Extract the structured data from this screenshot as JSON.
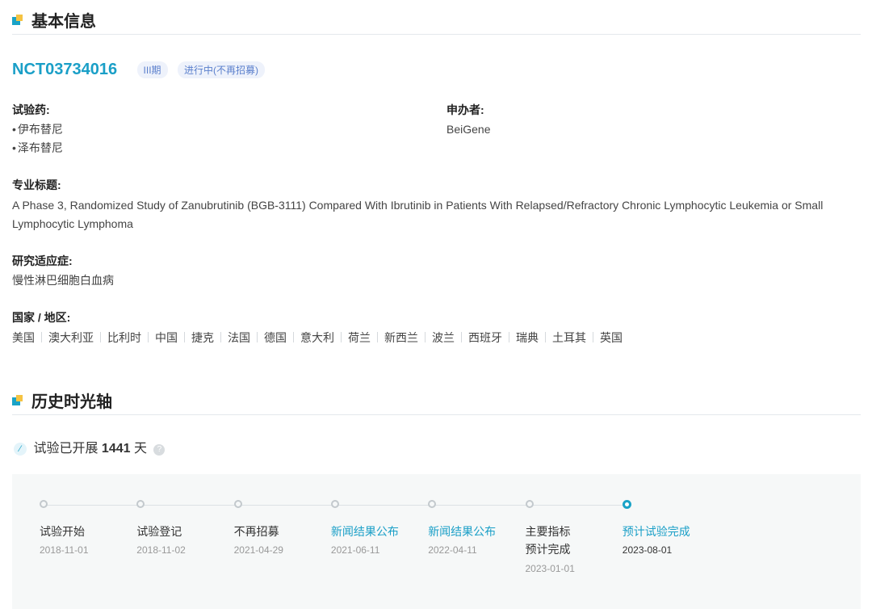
{
  "sections": {
    "basic_info": "基本信息",
    "timeline": "历史时光轴"
  },
  "trial": {
    "nct_id": "NCT03734016",
    "tags": [
      "III期",
      "进行中(不再招募)"
    ],
    "drug_label": "试验药:",
    "drugs": [
      "伊布替尼",
      "泽布替尼"
    ],
    "sponsor_label": "申办者:",
    "sponsor": "BeiGene",
    "title_label": "专业标题:",
    "title_line1": "A Phase 3, Randomized Study of Zanubrutinib (BGB-3111) Compared With Ibrutinib in Patients With Relapsed/Refractory Chronic Lymphocytic Leukemia or Small",
    "title_line2": "Lymphocytic Lymphoma",
    "indication_label": "研究适应症:",
    "indication": "慢性淋巴细胞白血病",
    "countries_label": "国家 / 地区:",
    "countries": [
      "美国",
      "澳大利亚",
      "比利时",
      "中国",
      "捷克",
      "法国",
      "德国",
      "意大利",
      "荷兰",
      "新西兰",
      "波兰",
      "西班牙",
      "瑞典",
      "土耳其",
      "英国"
    ]
  },
  "duration": {
    "prefix": "试验已开展",
    "days": "1441",
    "suffix": "天",
    "clip_icon": "paperclip-icon",
    "help_icon": "question-icon"
  },
  "timeline": [
    {
      "label": "试验开始",
      "date": "2018-11-01"
    },
    {
      "label": "试验登记",
      "date": "2018-11-02"
    },
    {
      "label": "不再招募",
      "date": "2021-04-29"
    },
    {
      "label": "新闻结果公布",
      "date": "2021-06-11"
    },
    {
      "label": "新闻结果公布",
      "date": "2022-04-11"
    },
    {
      "label": "主要指标",
      "label2": "预计完成",
      "date": "2023-01-01"
    },
    {
      "label": "预计试验完成",
      "date": "2023-08-01"
    }
  ],
  "colors": {
    "accent": "#1aa3c7",
    "tag_text": "#5a7fcc",
    "tag_bg": "#eef2fb"
  }
}
